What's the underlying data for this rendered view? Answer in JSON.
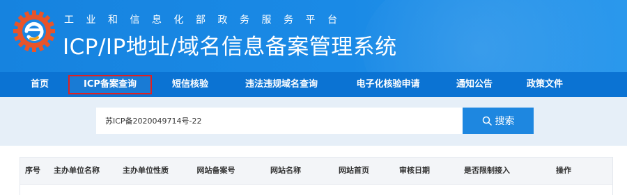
{
  "header": {
    "ministry": "工业和信息化部政务服务平台",
    "system_title": "ICP/IP地址/域名信息备案管理系统",
    "logo_icon": "miit-gear-e-logo-icon"
  },
  "nav": {
    "items": [
      {
        "label": "首页"
      },
      {
        "label": "ICP备案查询",
        "active": true
      },
      {
        "label": "短信核验"
      },
      {
        "label": "违法违规域名查询"
      },
      {
        "label": "电子化核验申请"
      },
      {
        "label": "通知公告"
      },
      {
        "label": "政策文件"
      }
    ]
  },
  "search": {
    "value": "苏ICP备2020049714号-22",
    "button_label": "搜索",
    "button_icon": "search-icon"
  },
  "table": {
    "headers": [
      "序号",
      "主办单位名称",
      "主办单位性质",
      "网站备案号",
      "网站名称",
      "网站首页",
      "审核日期",
      "是否限制接入",
      "操作"
    ]
  },
  "colors": {
    "header_blue": "#1a86e3",
    "nav_blue": "#0b73d3",
    "search_band": "#e6eff8",
    "button_blue": "#1e87e0",
    "active_border": "#e02020"
  }
}
